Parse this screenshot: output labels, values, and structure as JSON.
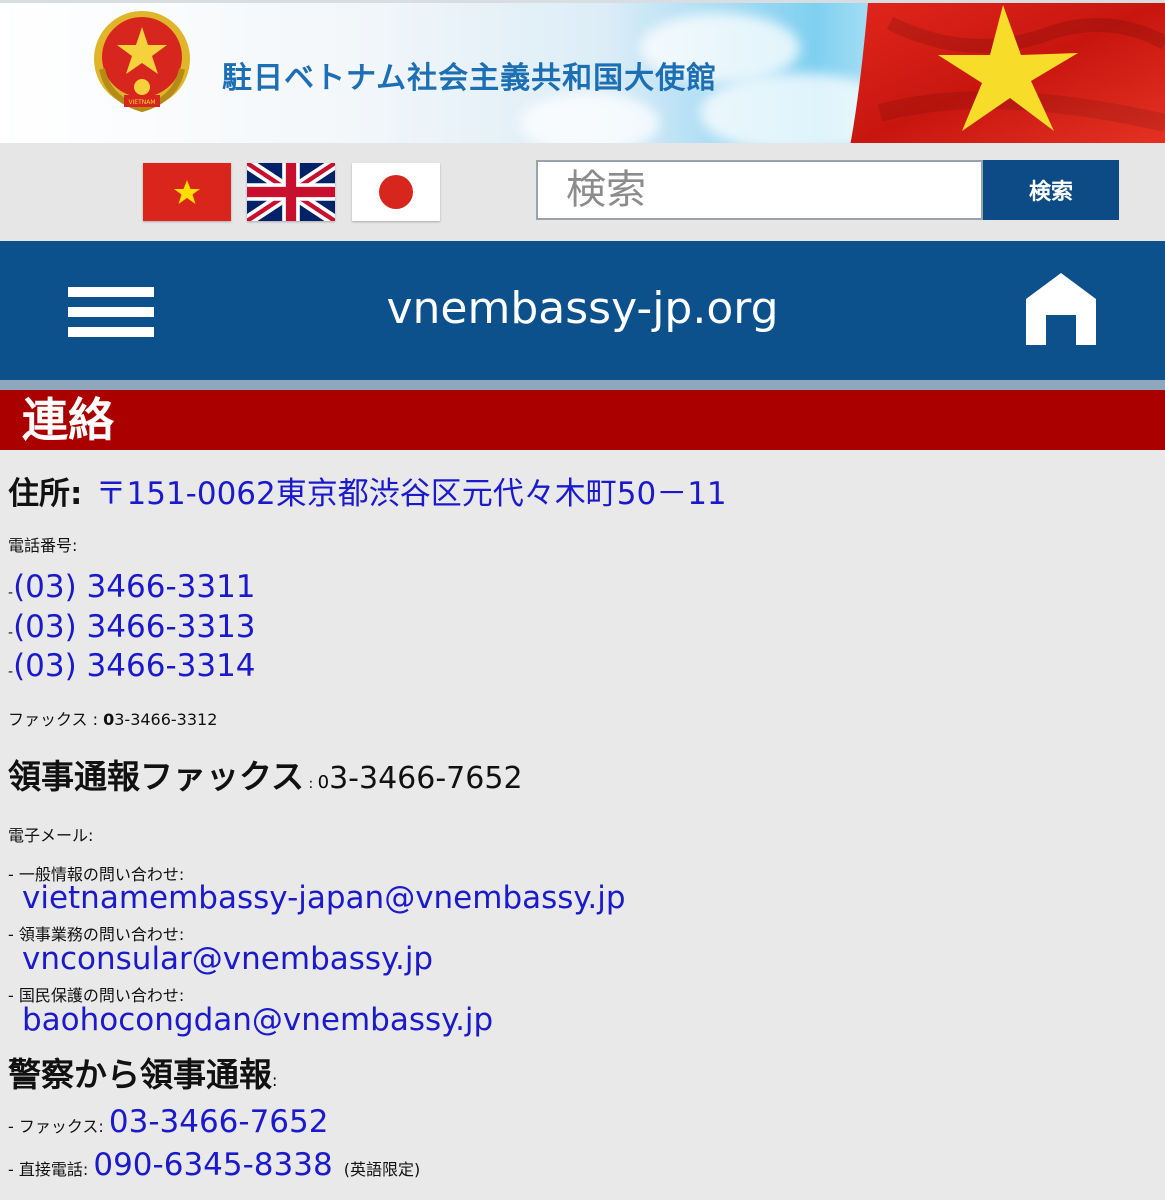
{
  "header": {
    "title": "駐日ベトナム社会主義共和国大使館",
    "emblem_text": "VIETNAM"
  },
  "languages": [
    {
      "name": "vietnamese-flag-icon"
    },
    {
      "name": "uk-flag-icon"
    },
    {
      "name": "japan-flag-icon"
    }
  ],
  "search": {
    "placeholder": "検索",
    "value": "",
    "button_label": "検索"
  },
  "nav": {
    "site_name": "vnembassy-jp.org",
    "menu_icon": "hamburger-menu-icon",
    "home_icon": "home-icon"
  },
  "section": {
    "title": "連絡"
  },
  "contact": {
    "address_label": "住所:",
    "address": "〒151-0062東京都渋谷区元代々木町50－11",
    "phone_label": "電話番号:",
    "phones": [
      "(03) 3466-3311",
      "(03) 3466-3313",
      "(03) 3466-3314"
    ],
    "bullet": "-",
    "fax_label": "ファックス : ",
    "fax_first": "0",
    "fax_rest": "3-3466-3312",
    "consular_fax_label": "領事通報ファックス",
    "consular_fax_sep": " : ",
    "consular_fax_first": "0",
    "consular_fax_rest": "3-3466-7652",
    "email_label": "電子メール:",
    "emails": [
      {
        "label": "- 一般情報の問い合わせ:",
        "address": "vietnamembassy-japan@vnembassy.jp"
      },
      {
        "label": "- 領事業務の問い合わせ:",
        "address": "vnconsular@vnembassy.jp"
      },
      {
        "label": "- 国民保護の問い合わせ:",
        "address": "baohocongdan@vnembassy.jp"
      }
    ],
    "police_label": "警察から領事通報",
    "police_colon": ":",
    "police_fax_label": "- ファックス:",
    "police_fax": "03-3466-7652",
    "police_phone_label": "- 直接電話:",
    "police_phone": "090-6345-8338",
    "police_phone_note": "(英語限定)"
  },
  "colors": {
    "nav_blue": "#0c508c",
    "section_red": "#ab0000",
    "link_blue": "#1a1acc",
    "banner_title": "#1d6fb4"
  }
}
